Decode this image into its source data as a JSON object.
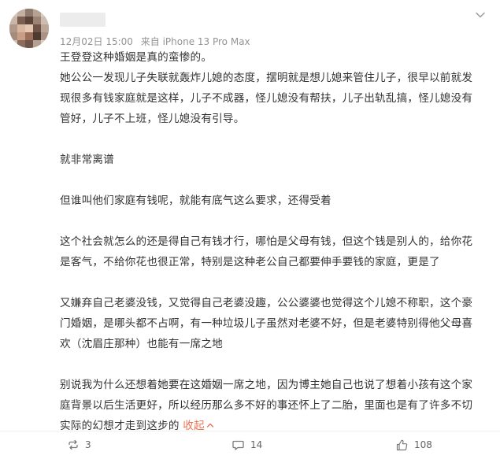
{
  "post": {
    "meta": {
      "date": "12月02日 15:00",
      "source": "来自 iPhone 13 Pro Max"
    },
    "paragraphs": [
      [
        "王登登这种婚姻是真的蛮惨的。"
      ],
      [
        "她公公一发现儿子失联就轰炸儿媳的态度，摆明就是想儿媳来管住儿子，很早以前就发",
        "现很多有钱家庭就是这样，儿子不成器，怪儿媳没有帮扶，儿子出轨乱搞，怪儿媳没有",
        "管好，儿子不上班，怪儿媳没有引导。"
      ],
      [
        "就非常离谱"
      ],
      [
        "但谁叫他们家庭有钱呢，就能有底气这么要求，还得受着"
      ],
      [
        "这个社会就怎么的还是得自己有钱才行，哪怕是父母有钱，但这个钱是别人的，给你花",
        "是客气，不给你花也很正常，特别是这种老公自己都要伸手要钱的家庭，更是了"
      ],
      [
        "又嫌弃自己老婆没钱，又觉得自己老婆没趣，公公婆婆也觉得这个儿媳不称职，这个豪",
        "门婚姻，是哪头都不占啊，有一种垃圾儿子虽然对老婆不好，但是老婆特别得他父母喜",
        "欢（沈眉庄那种）也能有一席之地"
      ],
      [
        "别说我为什么还想着她要在这婚姻一席之地，因为博主她自己也说了想着小孩有这个家",
        "庭背景以后生活更好，所以经历那么多不好的事还怀上了二胎，里面也是有了许多不切",
        "实际的幻想才走到这步的"
      ]
    ],
    "collapse_label": "收起",
    "collapse_icon": "chevron-up-icon"
  },
  "actions": {
    "repost_count": "3",
    "comment_count": "14",
    "like_count": "108"
  },
  "colors": {
    "text": "#333333",
    "meta": "#939393",
    "accent": "#eb7350",
    "icon": "#636363"
  }
}
